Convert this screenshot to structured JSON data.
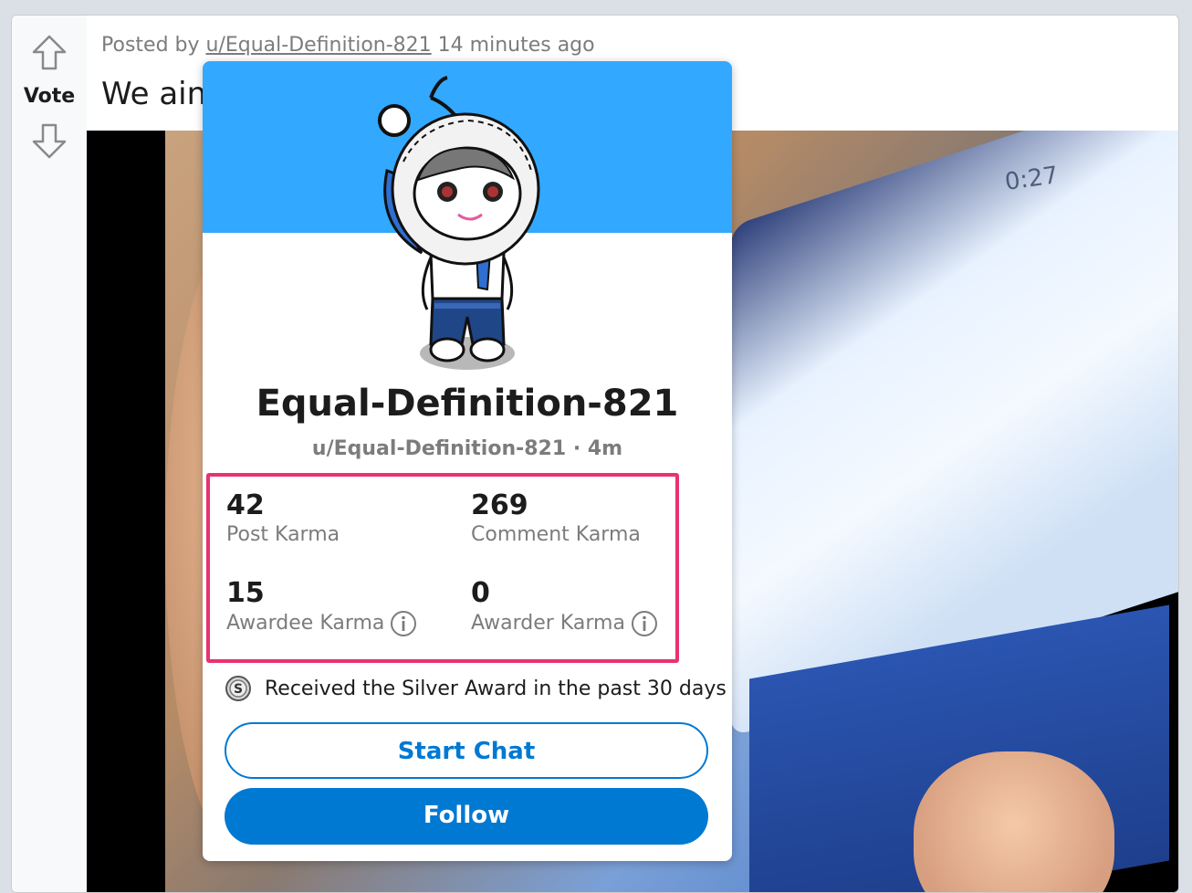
{
  "post": {
    "vote_label": "Vote",
    "meta_prefix": "Posted by",
    "author": "u/Equal-Definition-821",
    "time_ago": "14 minutes ago",
    "title_visible": "We ain'"
  },
  "video": {
    "timestamp": "0:27"
  },
  "hover_card": {
    "banner_color": "#33a8ff",
    "display_name": "Equal-Definition-821",
    "username_line": "u/Equal-Definition-821 · 4m",
    "karma": [
      {
        "value": "42",
        "label": "Post Karma"
      },
      {
        "value": "269",
        "label": "Comment Karma"
      },
      {
        "value": "15",
        "label": "Awardee Karma"
      },
      {
        "value": "0",
        "label": "Awarder Karma"
      }
    ],
    "award_text": "Received the Silver Award in the past 30 days",
    "start_chat_label": "Start Chat",
    "follow_label": "Follow",
    "highlight_color": "#e8336e",
    "accent_color": "#0079d3"
  },
  "icons": {
    "upvote": "arrow-up-icon",
    "downvote": "arrow-down-icon",
    "info": "info-icon",
    "award": "silver-award-icon",
    "avatar": "snoo-avatar-icon"
  }
}
